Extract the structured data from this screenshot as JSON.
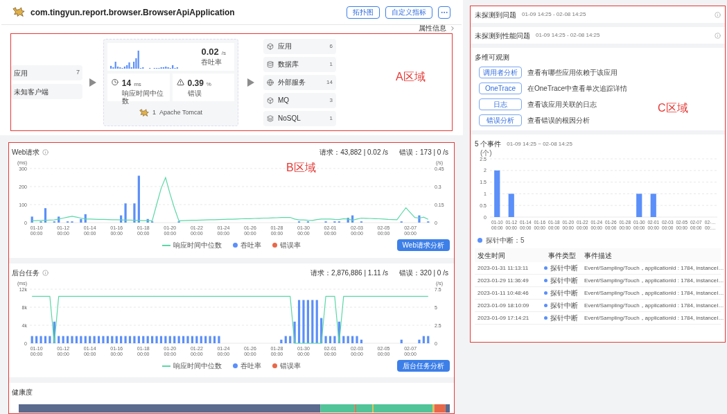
{
  "app": {
    "title": "com.tingyun.report.browser.BrowserApiApplication",
    "buttons": [
      "拓扑图",
      "自定义指标"
    ],
    "attr_link": "属性信息"
  },
  "flow": {
    "annotation": "A区域",
    "sources": [
      {
        "name": "应用",
        "count": "7"
      },
      {
        "name": "未知客户端"
      }
    ],
    "throughput": {
      "value": "0.02",
      "unit": "/s",
      "label": "吞吐率"
    },
    "response": {
      "value": "14",
      "unit": "ms",
      "label": "响应时间中位数"
    },
    "error": {
      "value": "0.39",
      "unit": "%",
      "label": "错误"
    },
    "instance": {
      "count": "1",
      "name": "Apache Tomcat"
    },
    "targets": [
      {
        "kind": "app",
        "name": "应用",
        "count": "6"
      },
      {
        "kind": "database",
        "name": "数据库",
        "count": "1"
      },
      {
        "kind": "external",
        "name": "外部服务",
        "count": "14"
      },
      {
        "kind": "mq",
        "name": "MQ",
        "count": "3"
      },
      {
        "kind": "nosql",
        "name": "NoSQL",
        "count": "1"
      }
    ]
  },
  "metrics": {
    "annotation": "B区域",
    "charts": [
      {
        "title": "Web请求",
        "requests": "请求：43,882 | 0.02 /s",
        "errors": "错误：173 | 0 /s",
        "button": "Web请求分析",
        "extra_legend": [
          {
            "label": "错误率",
            "color": "#e8684a"
          }
        ],
        "chart_data": {
          "type": "bar",
          "grid": true,
          "ylabel": "(ms)",
          "y2label": "(/s)",
          "ylim": [
            0,
            300
          ],
          "y2lim": [
            0,
            0.45
          ],
          "yticks": [
            0,
            100,
            200,
            300
          ],
          "y2ticks": [
            0,
            0.15,
            0.3,
            0.45
          ],
          "categories": [
            null,
            "01-10 00:00",
            null,
            null,
            null,
            null,
            null,
            "01-12 00:00",
            null,
            null,
            null,
            null,
            null,
            "01-14 00:00",
            null,
            null,
            null,
            null,
            null,
            "01-16 00:00",
            null,
            null,
            null,
            null,
            null,
            "01-18 00:00",
            null,
            null,
            null,
            null,
            null,
            "01-20 00:00",
            null,
            null,
            null,
            null,
            null,
            "01-22 00:00",
            null,
            null,
            null,
            null,
            null,
            "01-24 00:00",
            null,
            null,
            null,
            null,
            null,
            "01-26 00:00",
            null,
            null,
            null,
            null,
            null,
            "01-28 00:00",
            null,
            null,
            null,
            null,
            null,
            "01-30 00:00",
            null,
            null,
            null,
            null,
            null,
            "02-01 00:00",
            null,
            null,
            null,
            null,
            null,
            "02-03 00:00",
            null,
            null,
            null,
            null,
            null,
            "02-05 00:00",
            null,
            null,
            null,
            null,
            null,
            "02-07 00:00",
            null,
            null,
            null,
            null
          ],
          "series": [
            {
              "name": "响应时间中位数",
              "type": "line",
              "color": "#5ad8a6",
              "values": [
                10,
                11,
                12,
                13,
                14,
                15,
                20,
                25,
                30,
                35,
                30,
                25,
                20,
                20,
                19,
                18,
                18,
                17,
                16,
                16,
                15,
                14,
                14,
                13,
                12,
                11,
                11,
                10,
                100,
                190,
                250,
                160,
                80,
                10,
                11,
                12,
                13,
                13,
                14,
                15,
                16,
                16,
                17,
                18,
                19,
                19,
                20,
                21,
                22,
                22,
                23,
                24,
                25,
                25,
                26,
                27,
                28,
                28,
                29,
                20,
                15,
                15,
                13,
                12,
                17,
                20,
                20,
                20,
                18,
                17,
                22,
                20,
                13,
                20,
                25,
                24,
                23,
                22,
                21,
                20,
                18,
                17,
                16,
                50,
                82,
                55,
                28,
                25,
                30,
                18
              ]
            },
            {
              "name": "吞吐率",
              "type": "bar",
              "axis": "y2",
              "color": "#5b8ff9",
              "values": [
                0.05,
                null,
                0.01,
                0.12,
                null,
                0.01,
                0.05,
                null,
                0.01,
                0.01,
                null,
                0.03,
                0.07,
                null,
                null,
                null,
                null,
                null,
                null,
                null,
                0.06,
                0.16,
                null,
                0.16,
                0.39,
                null,
                0.03,
                0.01,
                null,
                null,
                null,
                null,
                null,
                0.01,
                null,
                null,
                null,
                null,
                null,
                null,
                null,
                null,
                null,
                null,
                null,
                null,
                null,
                null,
                null,
                null,
                null,
                null,
                null,
                null,
                null,
                null,
                null,
                null,
                null,
                null,
                0.01,
                null,
                0.01,
                null,
                null,
                null,
                0.01,
                null,
                0.01,
                0.01,
                null,
                0.04,
                0.06,
                null,
                0.01,
                null,
                null,
                null,
                null,
                null,
                null,
                null,
                null,
                0.01,
                null,
                null,
                null,
                0.06,
                null,
                0.01
              ]
            }
          ]
        }
      },
      {
        "title": "后台任务",
        "requests": "请求：2,876,886 | 1.11 /s",
        "errors": "错误：320 | 0 /s",
        "button": "后台任务分析",
        "extra_legend": [
          {
            "label": "错误率",
            "color": "#e8684a"
          }
        ],
        "chart_data": {
          "type": "bar",
          "grid": true,
          "ylabel": "(ms)",
          "y2label": "(/s)",
          "ylim": [
            0,
            12000
          ],
          "y2lim": [
            0,
            7.5
          ],
          "yticks": [
            0,
            {
              "value": 4000,
              "label": "4k"
            },
            {
              "value": 8000,
              "label": "8k"
            },
            {
              "value": 12000,
              "label": "12k"
            }
          ],
          "y2ticks": [
            0,
            2.5,
            5,
            7.5
          ],
          "categories": [
            null,
            "01-10 00:00",
            null,
            null,
            null,
            null,
            null,
            "01-12 00:00",
            null,
            null,
            null,
            null,
            null,
            "01-14 00:00",
            null,
            null,
            null,
            null,
            null,
            "01-16 00:00",
            null,
            null,
            null,
            null,
            null,
            "01-18 00:00",
            null,
            null,
            null,
            null,
            null,
            "01-20 00:00",
            null,
            null,
            null,
            null,
            null,
            "01-22 00:00",
            null,
            null,
            null,
            null,
            null,
            "01-24 00:00",
            null,
            null,
            null,
            null,
            null,
            "01-26 00:00",
            null,
            null,
            null,
            null,
            null,
            "01-28 00:00",
            null,
            null,
            null,
            null,
            null,
            "01-30 00:00",
            null,
            null,
            null,
            null,
            null,
            "02-01 00:00",
            null,
            null,
            null,
            null,
            null,
            "02-03 00:00",
            null,
            null,
            null,
            null,
            null,
            "02-05 00:00",
            null,
            null,
            null,
            null,
            null,
            "02-07 00:00",
            null,
            null,
            null,
            null
          ],
          "series": [
            {
              "name": "响应时间中位数",
              "type": "line",
              "color": "#5ad8a6",
              "values": [
                10400,
                10400,
                10400,
                10400,
                10400,
                0,
                10400,
                10400,
                10400,
                10400,
                10400,
                10400,
                10400,
                10400,
                10400,
                10400,
                10400,
                10400,
                10400,
                10400,
                10400,
                10400,
                10400,
                10400,
                10400,
                10400,
                10400,
                10400,
                10400,
                10400,
                10400,
                10400,
                10400,
                10400,
                10400,
                10400,
                10400,
                10400,
                10400,
                10400,
                10400,
                10400,
                10400,
                10400,
                10400,
                10400,
                10400,
                10400,
                10400,
                10400,
                10400,
                10400,
                10400,
                10400,
                10400,
                10400,
                10400,
                10400,
                10400,
                0,
                0,
                0,
                0,
                0,
                0,
                0,
                10400,
                10400,
                10400,
                0,
                10400,
                10400,
                10400,
                10400,
                10400,
                10400,
                10400,
                10400,
                10400,
                10400,
                10400,
                10400,
                10400,
                10400,
                10400,
                10400,
                10400,
                10400,
                10400,
                10400
              ]
            },
            {
              "name": "吞吐率",
              "type": "bar",
              "axis": "y2",
              "color": "#5b8ff9",
              "values": [
                1,
                1,
                1,
                1,
                1,
                3,
                1,
                1,
                1,
                1,
                1,
                1,
                1,
                1,
                1,
                1,
                1,
                1,
                1,
                1,
                1,
                1,
                1,
                1,
                1,
                1,
                1,
                1,
                1,
                1,
                1,
                1,
                1,
                1,
                1,
                1,
                1,
                1,
                1,
                1,
                1,
                1,
                1,
                null,
                null,
                null,
                null,
                null,
                null,
                null,
                null,
                null,
                null,
                null,
                null,
                null,
                0.5,
                1,
                1,
                3,
                6,
                6,
                6,
                6,
                6,
                3.5,
                1,
                1,
                1,
                3,
                1,
                1,
                1,
                1,
                0.5,
                null,
                null,
                null,
                null,
                null,
                null,
                null,
                null,
                0.5,
                null,
                null,
                null,
                0.5,
                1,
                1
              ]
            }
          ]
        }
      }
    ],
    "health": {
      "title": "健康度"
    }
  },
  "insights": {
    "annotation": "C区域",
    "status": [
      {
        "title": "未探测到问题",
        "range": "01-09 14:25 - 02-08 14:25"
      },
      {
        "title": "未探测到性能问题",
        "range": "01-09 14:25 - 02-08 14:25"
      }
    ],
    "observe": {
      "title": "多维可观测",
      "links": [
        {
          "button": "调用者分析",
          "text": "查看有哪些应用依赖于该应用"
        },
        {
          "button": "OneTrace",
          "text": "在OneTrace中查看单次追踪详情"
        },
        {
          "button": "日志",
          "text": "查看该应用关联的日志"
        },
        {
          "button": "错误分析",
          "text": "查看错误的根因分析"
        }
      ]
    },
    "events": {
      "count_title": "5 个事件",
      "range": "01-09 14:25 ~ 02-08 14:25",
      "chart_data": {
        "type": "bar",
        "grid": true,
        "ylabel": "(个)",
        "ylim": [
          0,
          2.5
        ],
        "yticks": [
          0,
          0.5,
          1,
          1.5,
          2,
          2.5
        ],
        "categories": [
          "01-10 00:00",
          "01-12 00:00",
          "01-14 00:00",
          "01-16 00:00",
          "01-18 00:00",
          "01-20 00:00",
          "01-22 00:00",
          "01-24 00:00",
          "01-26 00:00",
          "01-28 00:00",
          "01-30 00:00",
          "02-01 00:00",
          "02-03 00:00",
          "02-05 00:00",
          "02-07 00:00",
          "02-… 00:…"
        ],
        "series": [
          {
            "color": "#5b8ff9",
            "values": [
              2,
              1,
              0,
              0,
              0,
              0,
              0,
              0,
              0,
              0,
              1,
              1,
              0,
              0,
              0,
              0
            ]
          }
        ]
      },
      "legend": [
        {
          "label": "探针中断：5",
          "color": "#5b8ff9"
        }
      ],
      "columns": [
        "发生时间",
        "事件类型",
        "事件描述"
      ],
      "rows": [
        {
          "time": "2023-01-31 11:13:11",
          "type": "探针中断",
          "color": "#5b8ff9",
          "description": "Event/Sampling/Touch，applicationId : 1784, instanceI…"
        },
        {
          "time": "2023-01-29 11:36:49",
          "type": "探针中断",
          "color": "#5b8ff9",
          "description": "Event/Sampling/Touch，applicationId : 1784, instanceI…"
        },
        {
          "time": "2023-01-11 10:48:46",
          "type": "探针中断",
          "color": "#5b8ff9",
          "description": "Event/Sampling/Touch，applicationId : 1784, instanceI…"
        },
        {
          "time": "2023-01-09 18:10:09",
          "type": "探针中断",
          "color": "#5b8ff9",
          "description": "Event/Sampling/Touch，applicationId : 1784, instanceI…"
        },
        {
          "time": "2023-01-09 17:14:21",
          "type": "探针中断",
          "color": "#5b8ff9",
          "description": "Event/Sampling/Touch，applicationId : 1784, instanceI…"
        }
      ]
    }
  }
}
